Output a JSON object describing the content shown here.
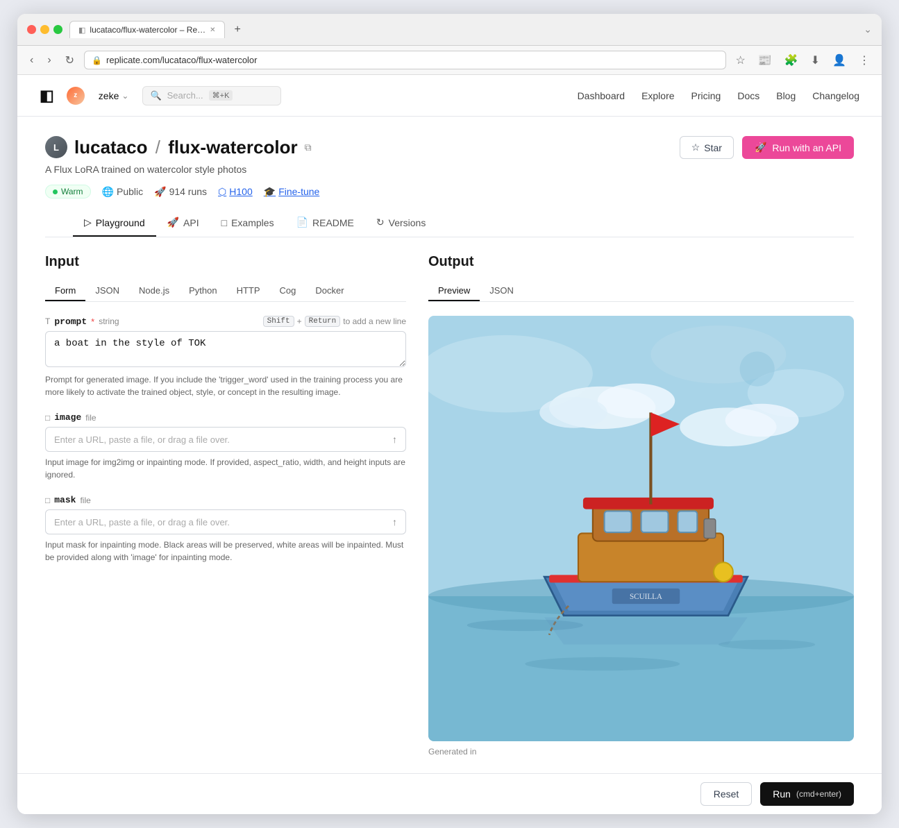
{
  "browser": {
    "url": "replicate.com/lucataco/flux-watercolor",
    "tab_title": "lucataco/flux-watercolor – Re…",
    "new_tab_label": "+"
  },
  "nav": {
    "logo_text": "◧",
    "user_name": "zeke",
    "search_placeholder": "Search...",
    "search_shortcut": "⌘+K",
    "links": [
      "Dashboard",
      "Explore",
      "Pricing",
      "Docs",
      "Blog",
      "Changelog"
    ]
  },
  "model": {
    "owner": "lucataco",
    "name": "flux-watercolor",
    "description": "A Flux LoRA trained on watercolor style photos",
    "badges": {
      "warm": "Warm",
      "visibility": "Public",
      "runs": "914 runs",
      "hardware": "H100",
      "type": "Fine-tune"
    },
    "star_label": "Star",
    "run_label": "Run with an API"
  },
  "tabs": {
    "model_tabs": [
      "Playground",
      "API",
      "Examples",
      "README",
      "Versions"
    ],
    "active_model_tab": "Playground"
  },
  "input": {
    "panel_title": "Input",
    "tabs": [
      "Form",
      "JSON",
      "Node.js",
      "Python",
      "HTTP",
      "Cog",
      "Docker"
    ],
    "active_tab": "Form",
    "fields": {
      "prompt": {
        "name": "prompt",
        "required": true,
        "type": "string",
        "value": "a boat in the style of TOK",
        "tok_word": "TOK",
        "hint_shift": "Shift",
        "hint_plus": "+",
        "hint_return": "Return",
        "hint_text": "to add a new line",
        "description": "Prompt for generated image. If you include the 'trigger_word' used in the training process you are more likely to activate the trained object, style, or concept in the resulting image."
      },
      "image": {
        "name": "image",
        "type": "file",
        "placeholder": "Enter a URL, paste a file, or drag a file over.",
        "description": "Input image for img2img or inpainting mode. If provided, aspect_ratio, width, and height inputs are ignored."
      },
      "mask": {
        "name": "mask",
        "type": "file",
        "placeholder": "Enter a URL, paste a file, or drag a file over.",
        "description": "Input mask for inpainting mode. Black areas will be preserved, white areas will be inpainted. Must be provided along with 'image' for inpainting mode."
      }
    },
    "reset_label": "Reset",
    "run_label": "Run",
    "run_shortcut": "(cmd+enter)"
  },
  "output": {
    "panel_title": "Output",
    "tabs": [
      "Preview",
      "JSON"
    ],
    "active_tab": "Preview",
    "generated_label": "Generated in"
  }
}
